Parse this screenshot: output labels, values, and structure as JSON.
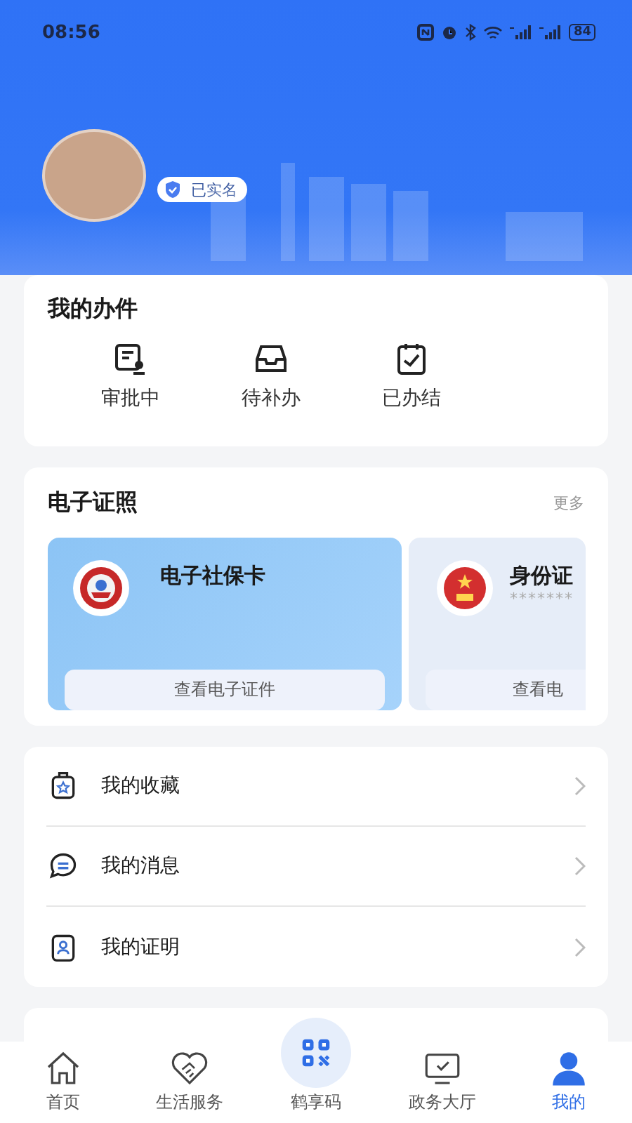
{
  "status_bar": {
    "time": "08:56",
    "battery": "84"
  },
  "profile": {
    "verified_badge": "已实名"
  },
  "my_affairs": {
    "title": "我的办件",
    "items": [
      {
        "label": "审批中",
        "kind": "approval"
      },
      {
        "label": "待补办",
        "kind": "inbox"
      },
      {
        "label": "已办结",
        "kind": "done"
      }
    ]
  },
  "licenses": {
    "title": "电子证照",
    "more": "更多",
    "cards": [
      {
        "kind": "social",
        "name": "电子社保卡",
        "button": "查看电子证件"
      },
      {
        "kind": "id",
        "name": "身份证",
        "masked": "*******",
        "button": "查看电"
      }
    ]
  },
  "menu": [
    {
      "label": "我的收藏",
      "kind": "favorite"
    },
    {
      "label": "我的消息",
      "kind": "message"
    },
    {
      "label": "我的证明",
      "kind": "certificate"
    }
  ],
  "tabs": [
    {
      "label": "首页",
      "kind": "home",
      "selected": false
    },
    {
      "label": "生活服务",
      "kind": "service",
      "selected": false
    },
    {
      "label": "鹤享码",
      "kind": "code",
      "selected": false
    },
    {
      "label": "政务大厅",
      "kind": "hall",
      "selected": false
    },
    {
      "label": "我的",
      "kind": "me",
      "selected": true
    }
  ]
}
